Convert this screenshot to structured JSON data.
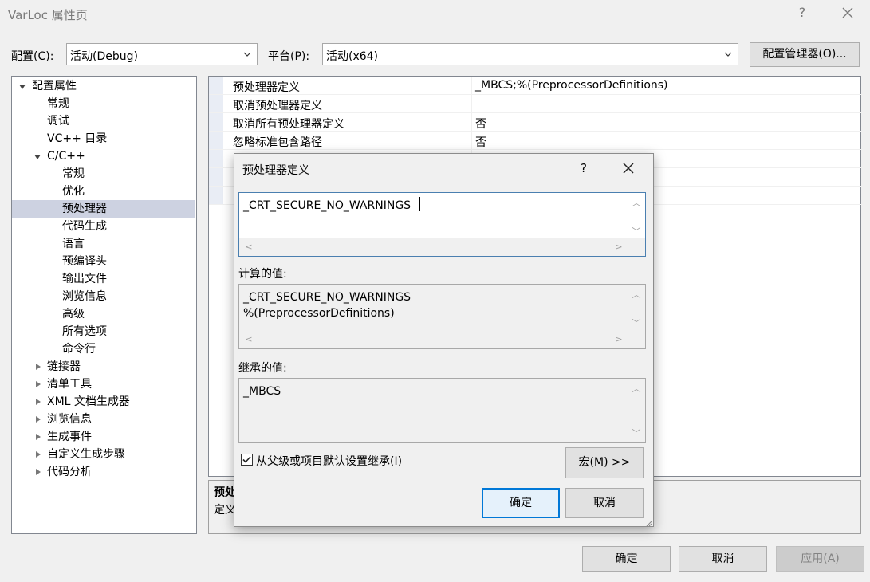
{
  "window": {
    "title": "VarLoc 属性页",
    "help": "?"
  },
  "config": {
    "label": "配置(C):",
    "value": "活动(Debug)",
    "platform_label": "平台(P):",
    "platform_value": "活动(x64)",
    "manager_button": "配置管理器(O)..."
  },
  "tree": {
    "items": [
      {
        "label": "配置属性"
      },
      {
        "label": "常规"
      },
      {
        "label": "调试"
      },
      {
        "label": "VC++ 目录"
      },
      {
        "label": "C/C++"
      },
      {
        "label": "常规"
      },
      {
        "label": "优化"
      },
      {
        "label": "预处理器"
      },
      {
        "label": "代码生成"
      },
      {
        "label": "语言"
      },
      {
        "label": "预编译头"
      },
      {
        "label": "输出文件"
      },
      {
        "label": "浏览信息"
      },
      {
        "label": "高级"
      },
      {
        "label": "所有选项"
      },
      {
        "label": "命令行"
      },
      {
        "label": "链接器"
      },
      {
        "label": "清单工具"
      },
      {
        "label": "XML 文档生成器"
      },
      {
        "label": "浏览信息"
      },
      {
        "label": "生成事件"
      },
      {
        "label": "自定义生成步骤"
      },
      {
        "label": "代码分析"
      }
    ]
  },
  "grid": {
    "rows": [
      {
        "name": "预处理器定义",
        "value": "_MBCS;%(PreprocessorDefinitions)"
      },
      {
        "name": "取消预处理器定义",
        "value": ""
      },
      {
        "name": "取消所有预处理器定义",
        "value": "否"
      },
      {
        "name": "忽略标准包含路径",
        "value": "否"
      }
    ]
  },
  "description": {
    "title": "预处",
    "text": "定义"
  },
  "dialog": {
    "title": "预处理器定义",
    "help": "?",
    "edit_value": "_CRT_SECURE_NO_WARNINGS",
    "computed_label": "计算的值:",
    "computed_value": "_CRT_SECURE_NO_WARNINGS\n%(PreprocessorDefinitions)",
    "inherited_label": "继承的值:",
    "inherited_value": "_MBCS",
    "inherit_checkbox": "从父级或项目默认设置继承(I)",
    "inherit_checked": true,
    "macro_button": "宏(M) >>",
    "ok_button": "确定",
    "cancel_button": "取消"
  },
  "footer": {
    "ok": "确定",
    "cancel": "取消",
    "apply": "应用(A)"
  },
  "colors": {
    "accent": "#0078d7",
    "selection": "#cdd2e1"
  }
}
